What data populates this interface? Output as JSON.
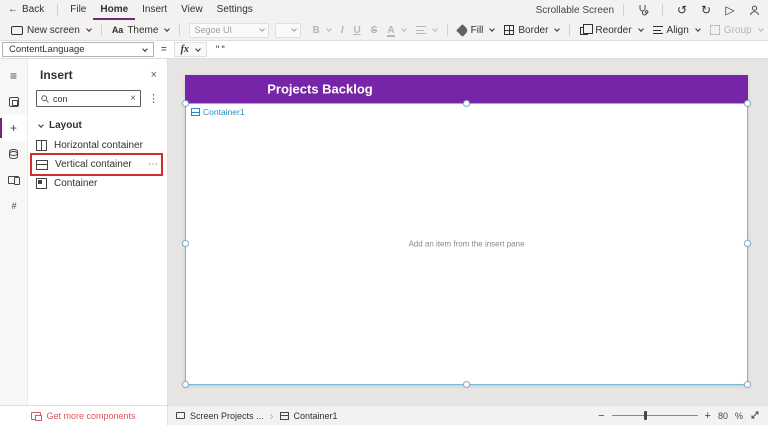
{
  "titlebar": {
    "back_label": "Back",
    "menu_items": [
      "File",
      "Home",
      "Insert",
      "View",
      "Settings"
    ],
    "active_item": "Home",
    "screen_label": "Scrollable Screen",
    "icons": {
      "back": "←",
      "undo": "↺",
      "redo": "↻",
      "play": "▷"
    }
  },
  "ribbon": {
    "new_screen_label": "New screen",
    "theme_label": "Theme",
    "theme_icon_glyph": "Aa",
    "font_name": "Segoe UI",
    "bold": "B",
    "italic": "I",
    "underline": "U",
    "strike": "S",
    "font_color": "A",
    "fill_label": "Fill",
    "border_label": "Border",
    "reorder_label": "Reorder",
    "align_label": "Align",
    "group_label": "Group"
  },
  "formula_bar": {
    "property": "ContentLanguage",
    "equals": "=",
    "fx_label": "fx",
    "formula": "\"\""
  },
  "rail": {
    "hamburger": "≡",
    "plus": "+",
    "tools_glyph": "#"
  },
  "insert_panel": {
    "title": "Insert",
    "close_glyph": "×",
    "search_value": "con",
    "search_clear_glyph": "×",
    "more_glyph": "⋮",
    "section_label": "Layout",
    "items": [
      {
        "label": "Horizontal container"
      },
      {
        "label": "Vertical container",
        "more_glyph": "⋯"
      },
      {
        "label": "Container"
      }
    ],
    "footer_link": "Get more components"
  },
  "canvas": {
    "screen_header": "Projects Backlog",
    "container_label": "Container1",
    "placeholder_text": "Add an item from the insert pane"
  },
  "statusbar": {
    "breadcrumb": [
      {
        "label": "Screen Projects ..."
      },
      {
        "label": "Container1"
      }
    ],
    "separator_glyph": "›",
    "zoom_out_glyph": "−",
    "zoom_in_glyph": "+",
    "zoom_percent": "80",
    "percent_sign": "%"
  },
  "colors": {
    "brand_purple": "#742774",
    "screen_header_purple": "#7624a8",
    "selection_blue": "#74b9dc",
    "highlight_red": "#cf2e31",
    "link_pink": "#d85961",
    "chrome_gray": "#f3f2f1"
  }
}
